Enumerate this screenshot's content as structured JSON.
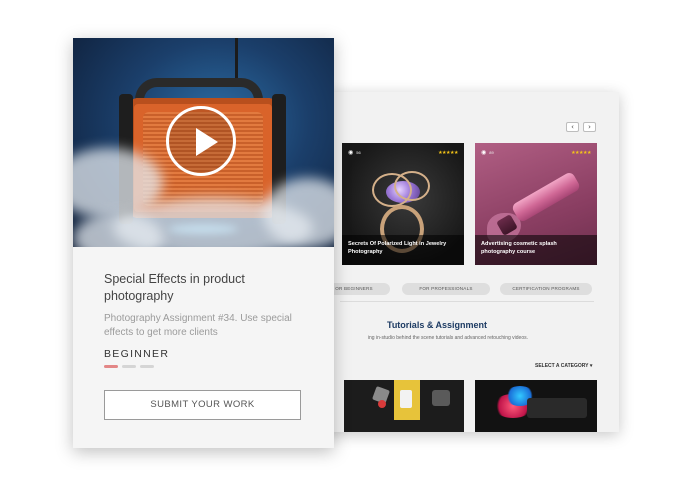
{
  "product_card": {
    "title": "Special Effects in product photography",
    "description": "Photography Assignment #34. Use special effects to get more clients",
    "level": "BEGINNER",
    "level_progress": {
      "filled": 1,
      "total": 3
    },
    "submit_label": "SUBMIT YOUR WORK",
    "hero_icon": "play-icon"
  },
  "browser": {
    "nav": {
      "prev": "‹",
      "next": "›"
    },
    "courses": [
      {
        "views": "56",
        "stars": "★★★★★",
        "caption": "Secrets Of Polarized Light in Jewelry Photography"
      },
      {
        "views": "89",
        "stars": "★★★★★",
        "caption": "Advertising cosmetic splash photography course"
      }
    ],
    "filters": [
      "OR BEGINNERS",
      "FOR PROFESSIONALS",
      "CERTIFICATION PROGRAMS"
    ],
    "section_title": "Tutorials & Assignment",
    "section_subtitle": "ing in-studio behind the scene tutorials and advanced retouching videos.",
    "category_select": "SELECT A CATEGORY ▾"
  },
  "colors": {
    "accent": "#e38787",
    "title_blue": "#1d3b63",
    "star": "#f5c518"
  }
}
